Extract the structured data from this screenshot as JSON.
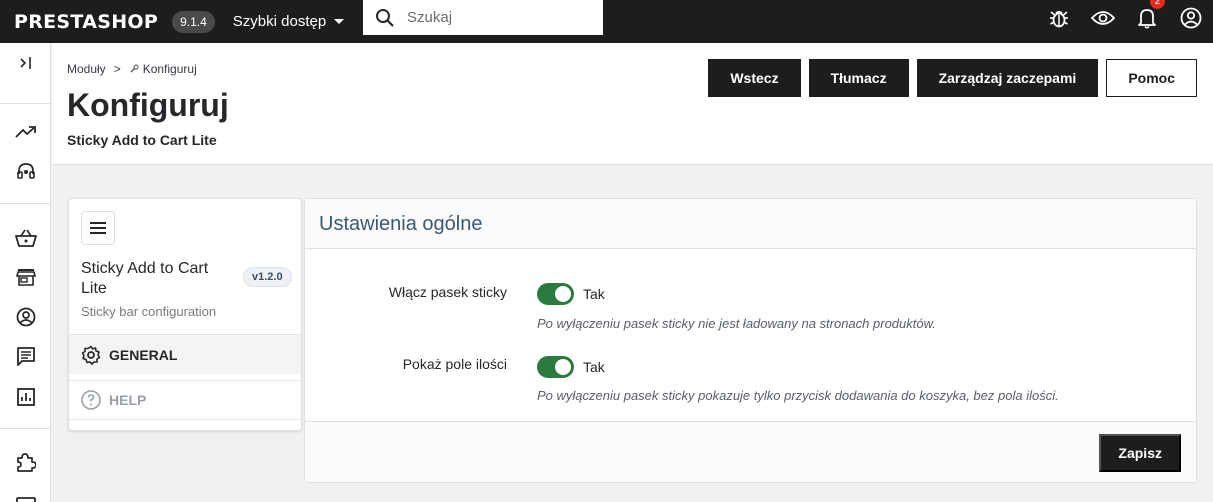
{
  "topbar": {
    "logo": "PRESTASHOP",
    "version": "9.1.4",
    "quick_access": "Szybki dostęp",
    "search_placeholder": "Szukaj",
    "notification_count": "2"
  },
  "leftnav": {
    "items": [
      "collapse-icon",
      "trend-icon",
      "support-icon",
      "basket-icon",
      "store-icon",
      "user-icon",
      "message-icon",
      "stats-icon",
      "puzzle-icon",
      "display-icon"
    ]
  },
  "header": {
    "breadcrumb": [
      "Moduły",
      "Konfiguruj"
    ],
    "breadcrumb_sep": ">",
    "title": "Konfiguruj",
    "subtitle": "Sticky Add to Cart Lite",
    "buttons": {
      "back": "Wstecz",
      "translate": "Tłumacz",
      "hooks": "Zarządzaj zaczepami",
      "help": "Pomoc"
    }
  },
  "module_panel": {
    "name": "Sticky Add to Cart Lite",
    "version": "v1.2.0",
    "description": "Sticky bar configuration",
    "menu": {
      "general": "GENERAL",
      "help": "HELP"
    }
  },
  "settings": {
    "title": "Ustawienia ogólne",
    "fields": [
      {
        "label": "Włącz pasek sticky",
        "value": "Tak",
        "enabled": true,
        "help": "Po wyłączeniu pasek sticky nie jest ładowany na stronach produktów."
      },
      {
        "label": "Pokaż pole ilości",
        "value": "Tak",
        "enabled": true,
        "help": "Po wyłączeniu pasek sticky pokazuje tylko przycisk dodawania do koszyka, bez pola ilości."
      }
    ],
    "save": "Zapisz"
  },
  "colors": {
    "topbar": "#1d1d1b",
    "switch_on": "#2b7a3f",
    "card_title": "#3c5872",
    "badge": "#e32b1d"
  }
}
